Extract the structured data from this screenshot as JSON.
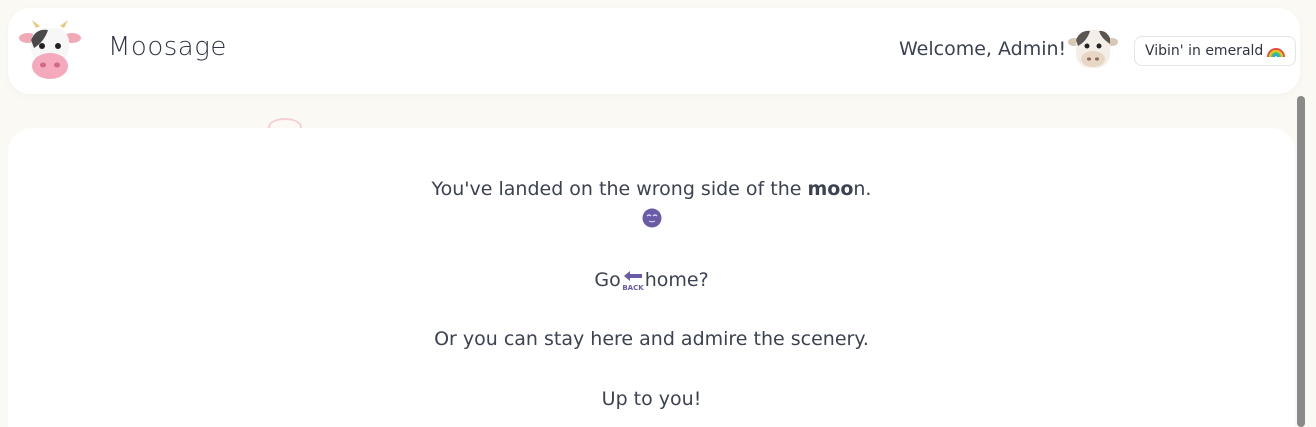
{
  "header": {
    "brand": "Moosage",
    "welcome": "Welcome, Admin!",
    "theme_label": "Vibin' in emerald",
    "theme_icon": "rainbow-icon",
    "logo_icon": "cow-face-icon",
    "avatar_icon": "cow-avatar-icon"
  },
  "message": {
    "line1_prefix": "You've landed on the wrong side of the ",
    "line1_bold": "moo",
    "line1_suffix": "n.",
    "face_icon": "purple-face-emoji",
    "line2_prefix": "Go",
    "back_icon_text": "BACK",
    "line2_suffix": "home?",
    "line3": "Or you can stay here and admire the scenery.",
    "line4": "Up to you!"
  },
  "colors": {
    "background": "#fbf9f3",
    "card": "#ffffff",
    "text": "#3b4252",
    "accent_purple": "#6b5aa6"
  }
}
